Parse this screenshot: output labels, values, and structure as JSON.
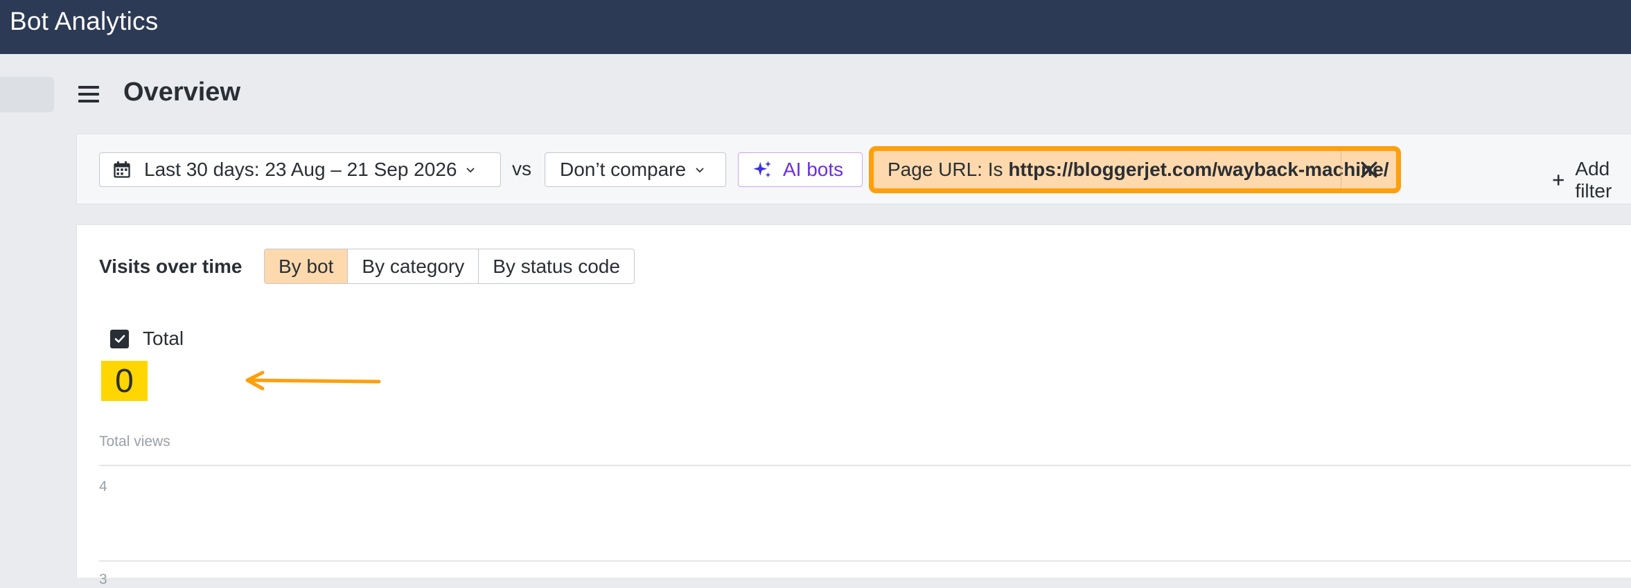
{
  "app": {
    "title": "Bot Analytics"
  },
  "header": {
    "title": "Overview"
  },
  "filters": {
    "date_range": "Last 30 days: 23 Aug – 21 Sep 2026",
    "vs_label": "vs",
    "compare": "Don’t compare",
    "ai_bots": "AI bots",
    "page_url": {
      "prefix": "Page URL: Is ",
      "value": "https://bloggerjet.com/wayback-machine/"
    },
    "add_filter": "Add filter"
  },
  "visits": {
    "title": "Visits over time",
    "tabs": [
      {
        "label": "By bot",
        "active": true
      },
      {
        "label": "By category",
        "active": false
      },
      {
        "label": "By status code",
        "active": false
      }
    ],
    "total_label": "Total",
    "total_checked": true,
    "total_value": "0",
    "highlight_color": "#ffd600",
    "annotation_arrow_color": "#ff9f0a",
    "y_axis_title": "Total views",
    "y_ticks": [
      "4",
      "3"
    ]
  },
  "colors": {
    "topbar": "#2d3a55",
    "filter_highlight": "#ff9f0a",
    "active_tab": "#fdd9ad",
    "ai_accent": "#6b2fe0"
  }
}
